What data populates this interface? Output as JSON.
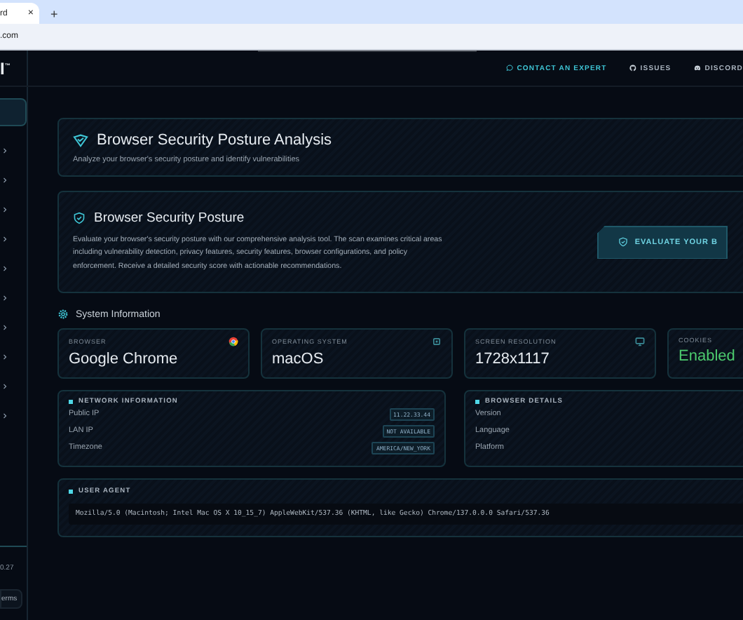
{
  "browser_tab": {
    "title": "rd",
    "close": "×",
    "new_tab": "+"
  },
  "address_bar": {
    "url": ".com"
  },
  "logo": "I$^{™}$",
  "header_links": [
    {
      "kind": "chat",
      "label": "CONTACT AN EXPERT"
    },
    {
      "kind": "github",
      "label": "ISSUES"
    },
    {
      "kind": "discord",
      "label": "DISCORD"
    }
  ],
  "sidebar": {
    "items": [
      {
        "selected": true
      },
      {
        "selected": false
      },
      {
        "selected": false
      },
      {
        "selected": false
      },
      {
        "selected": false
      },
      {
        "selected": false
      },
      {
        "selected": false
      },
      {
        "selected": false
      },
      {
        "selected": false
      },
      {
        "selected": false
      },
      {
        "selected": false
      }
    ],
    "version": "0.27",
    "terms": "erms"
  },
  "page_header": {
    "title": "Browser Security Posture Analysis",
    "subtitle": "Analyze your browser's security posture and identify vulnerabilities"
  },
  "posture_card": {
    "title": "Browser Security Posture",
    "description": "Evaluate your browser's security posture with our comprehensive analysis tool. The scan examines critical areas including vulnerability detection, privacy features, security features, browser configurations, and policy enforcement. Receive a detailed security score with actionable recommendations.",
    "button": "EVALUATE YOUR B"
  },
  "system_information": {
    "title": "System Information",
    "stats": [
      {
        "kind": "browser",
        "label": "BROWSER",
        "value": "Google Chrome"
      },
      {
        "kind": "os",
        "label": "OPERATING SYSTEM",
        "value": "macOS"
      },
      {
        "kind": "screen",
        "label": "SCREEN RESOLUTION",
        "value": "1728x1117"
      },
      {
        "kind": "cookies",
        "label": "COOKIES",
        "value": "Enabled"
      }
    ],
    "network": {
      "title": "NETWORK INFORMATION",
      "rows": [
        {
          "label": "Public IP",
          "value": "11.22.33.44"
        },
        {
          "label": "LAN IP",
          "value": "NOT AVAILABLE"
        },
        {
          "label": "Timezone",
          "value": "AMERICA/NEW_YORK"
        }
      ]
    },
    "browser_details": {
      "title": "BROWSER DETAILS",
      "rows": [
        {
          "label": "Version"
        },
        {
          "label": "Language"
        },
        {
          "label": "Platform"
        }
      ]
    },
    "user_agent": {
      "title": "USER AGENT",
      "value": "Mozilla/5.0 (Macintosh; Intel Mac OS X 10_15_7) AppleWebKit/537.36 (KHTML, like Gecko) Chrome/137.0.0.0 Safari/537.36"
    }
  }
}
